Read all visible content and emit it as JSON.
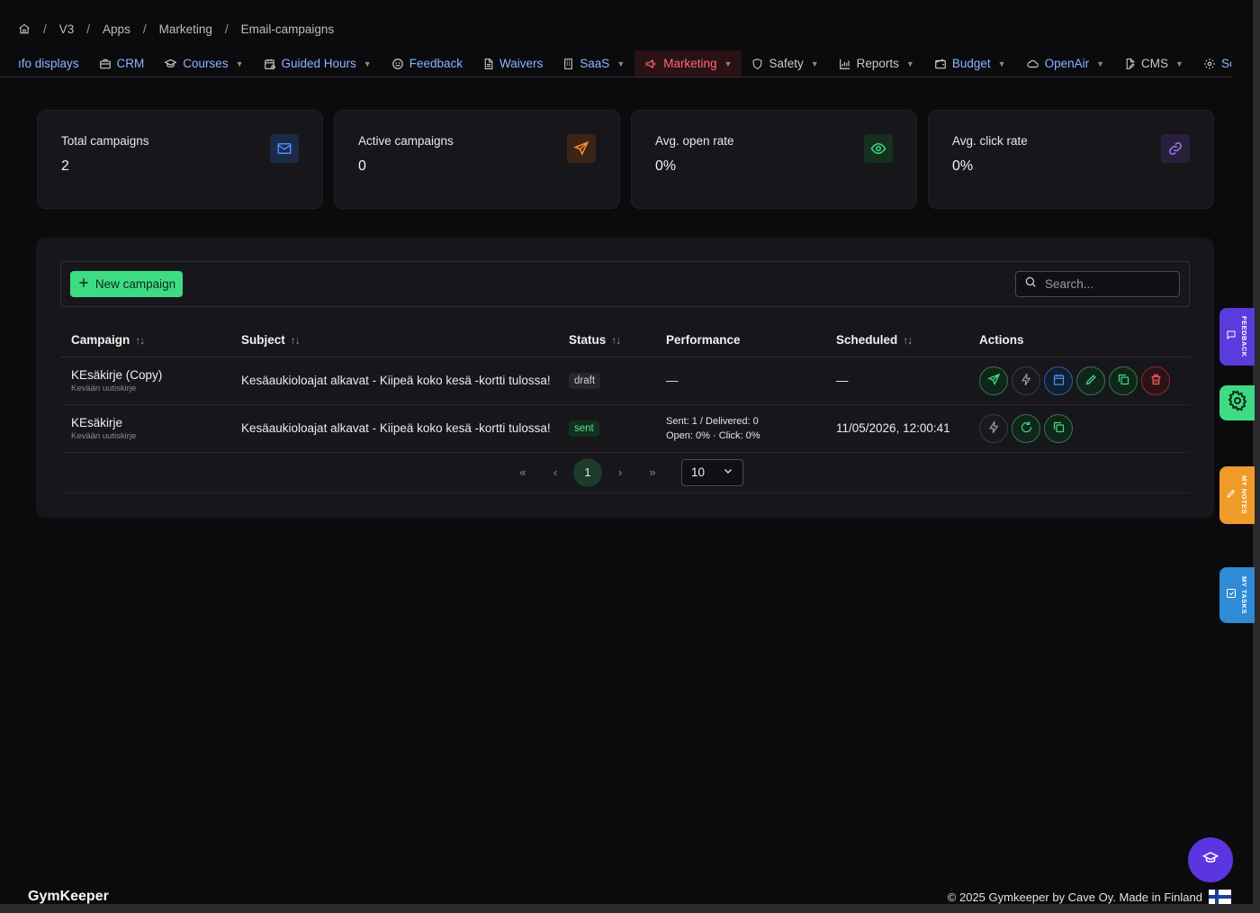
{
  "breadcrumb": {
    "items": [
      "V3",
      "Apps",
      "Marketing",
      "Email-campaigns"
    ],
    "separator": "/"
  },
  "nav": {
    "items": [
      {
        "label": "ıfo displays",
        "icon": "none",
        "chevron": false
      },
      {
        "label": "CRM",
        "icon": "briefcase-icon",
        "chevron": false
      },
      {
        "label": "Courses",
        "icon": "graduation-cap-icon",
        "chevron": true
      },
      {
        "label": "Guided Hours",
        "icon": "calendar-clock-icon",
        "chevron": true
      },
      {
        "label": "Feedback",
        "icon": "smile-icon",
        "chevron": false
      },
      {
        "label": "Waivers",
        "icon": "document-icon",
        "chevron": false
      },
      {
        "label": "SaaS",
        "icon": "building-icon",
        "chevron": true
      },
      {
        "label": "Marketing",
        "icon": "megaphone-icon",
        "chevron": true,
        "active": true
      },
      {
        "label": "Safety",
        "icon": "shield-icon",
        "chevron": true
      },
      {
        "label": "Reports",
        "icon": "bar-chart-icon",
        "chevron": true
      },
      {
        "label": "Budget",
        "icon": "wallet-icon",
        "chevron": true
      },
      {
        "label": "OpenAir",
        "icon": "cloud-icon",
        "chevron": true
      },
      {
        "label": "CMS",
        "icon": "file-edit-icon",
        "chevron": true
      },
      {
        "label": "Settings",
        "icon": "gear-icon",
        "chevron": false
      }
    ]
  },
  "stats": [
    {
      "label": "Total campaigns",
      "value": "2",
      "icon": "mail-icon",
      "color": "#4f8cff",
      "bg": "#1b2a45"
    },
    {
      "label": "Active campaigns",
      "value": "0",
      "icon": "send-icon",
      "color": "#ff8a2a",
      "bg": "#3a2416"
    },
    {
      "label": "Avg. open rate",
      "value": "0%",
      "icon": "eye-icon",
      "color": "#3ddc84",
      "bg": "#15301f"
    },
    {
      "label": "Avg. click rate",
      "value": "0%",
      "icon": "link-icon",
      "color": "#a37bff",
      "bg": "#29213b"
    }
  ],
  "toolbar": {
    "new_label": "New campaign",
    "search_placeholder": "Search..."
  },
  "table": {
    "headers": {
      "campaign": "Campaign",
      "subject": "Subject",
      "status": "Status",
      "performance": "Performance",
      "scheduled": "Scheduled",
      "actions": "Actions"
    },
    "sort_glyph": "↑↓",
    "rows": [
      {
        "name": "KEsäkirje (Copy)",
        "list": "Kevään uutiskirje",
        "subject": "Kesäaukioloajat alkavat - Kiipeä koko kesä -kortti tulossa!",
        "status": "draft",
        "perf_line1": "—",
        "perf_line2": "",
        "scheduled": "—"
      },
      {
        "name": "KEsäkirje",
        "list": "Kevään uutiskirje",
        "subject": "Kesäaukioloajat alkavat - Kiipeä koko kesä -kortti tulossa!",
        "status": "sent",
        "perf_line1": "Sent: 1 / Delivered: 0",
        "perf_line2": "Open: 0% · Click: 0%",
        "scheduled": "11/05/2026, 12:00:41"
      }
    ]
  },
  "pagination": {
    "first": "«",
    "prev": "‹",
    "current": "1",
    "next": "›",
    "last": "»",
    "page_size": "10"
  },
  "side_tabs": {
    "feedback": "FEEDBACK",
    "notes": "MY NOTES",
    "tasks": "MY TASKS"
  },
  "footer": {
    "brand": "GymKeeper",
    "copyright": "© 2025 Gymkeeper by Cave Oy. Made in Finland"
  },
  "colors": {
    "accent_green": "#3ddc84",
    "nav_link": "#8fb3ff",
    "active_red": "#ff6b7a",
    "fab_purple": "#5b35e0"
  }
}
